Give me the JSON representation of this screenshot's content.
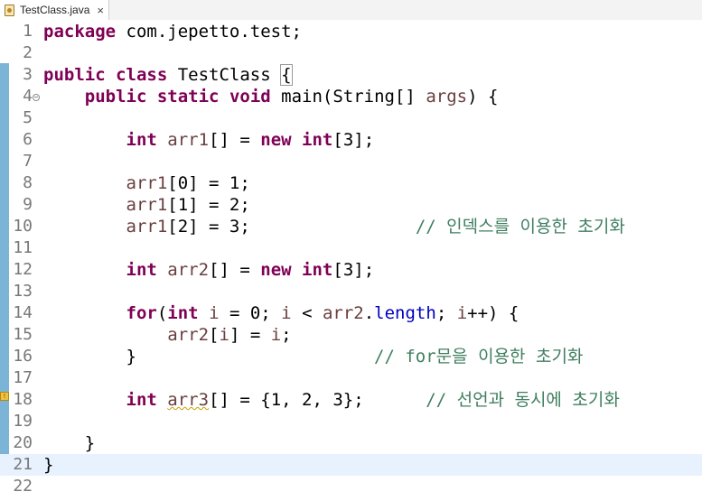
{
  "tab": {
    "filename": "TestClass.java",
    "close_glyph": "×"
  },
  "lines": [
    {
      "num": "1",
      "tokens": [
        {
          "t": "package",
          "c": "kw"
        },
        {
          "t": " com.jepetto.test;"
        }
      ]
    },
    {
      "num": "2",
      "tokens": []
    },
    {
      "num": "3",
      "tokens": [
        {
          "t": "public",
          "c": "kw"
        },
        {
          "t": " "
        },
        {
          "t": "class",
          "c": "kw"
        },
        {
          "t": " TestClass "
        },
        {
          "t": "{",
          "c": "brace-hl"
        }
      ]
    },
    {
      "num": "4",
      "fold": "−",
      "tokens": [
        {
          "t": "    "
        },
        {
          "t": "public",
          "c": "kw"
        },
        {
          "t": " "
        },
        {
          "t": "static",
          "c": "kw"
        },
        {
          "t": " "
        },
        {
          "t": "void",
          "c": "kw"
        },
        {
          "t": " main(String[] "
        },
        {
          "t": "args",
          "c": "local"
        },
        {
          "t": ") {"
        }
      ]
    },
    {
      "num": "5",
      "tokens": []
    },
    {
      "num": "6",
      "tokens": [
        {
          "t": "        "
        },
        {
          "t": "int",
          "c": "kw"
        },
        {
          "t": " "
        },
        {
          "t": "arr1",
          "c": "local"
        },
        {
          "t": "[] = "
        },
        {
          "t": "new",
          "c": "kw"
        },
        {
          "t": " "
        },
        {
          "t": "int",
          "c": "kw"
        },
        {
          "t": "[3];"
        }
      ]
    },
    {
      "num": "7",
      "tokens": []
    },
    {
      "num": "8",
      "tokens": [
        {
          "t": "        "
        },
        {
          "t": "arr1",
          "c": "local"
        },
        {
          "t": "[0] = 1;"
        }
      ]
    },
    {
      "num": "9",
      "tokens": [
        {
          "t": "        "
        },
        {
          "t": "arr1",
          "c": "local"
        },
        {
          "t": "[1] = 2;"
        }
      ]
    },
    {
      "num": "10",
      "tokens": [
        {
          "t": "        "
        },
        {
          "t": "arr1",
          "c": "local"
        },
        {
          "t": "[2] = 3;                "
        },
        {
          "t": "// 인덱스를 이용한 초기화",
          "c": "comment"
        }
      ]
    },
    {
      "num": "11",
      "tokens": []
    },
    {
      "num": "12",
      "tokens": [
        {
          "t": "        "
        },
        {
          "t": "int",
          "c": "kw"
        },
        {
          "t": " "
        },
        {
          "t": "arr2",
          "c": "local"
        },
        {
          "t": "[] = "
        },
        {
          "t": "new",
          "c": "kw"
        },
        {
          "t": " "
        },
        {
          "t": "int",
          "c": "kw"
        },
        {
          "t": "[3];"
        }
      ]
    },
    {
      "num": "13",
      "tokens": []
    },
    {
      "num": "14",
      "tokens": [
        {
          "t": "        "
        },
        {
          "t": "for",
          "c": "kw"
        },
        {
          "t": "("
        },
        {
          "t": "int",
          "c": "kw"
        },
        {
          "t": " "
        },
        {
          "t": "i",
          "c": "local"
        },
        {
          "t": " = 0; "
        },
        {
          "t": "i",
          "c": "local"
        },
        {
          "t": " < "
        },
        {
          "t": "arr2",
          "c": "local"
        },
        {
          "t": "."
        },
        {
          "t": "length",
          "c": "field"
        },
        {
          "t": "; "
        },
        {
          "t": "i",
          "c": "local"
        },
        {
          "t": "++) {"
        }
      ]
    },
    {
      "num": "15",
      "tokens": [
        {
          "t": "            "
        },
        {
          "t": "arr2",
          "c": "local"
        },
        {
          "t": "["
        },
        {
          "t": "i",
          "c": "local"
        },
        {
          "t": "] = "
        },
        {
          "t": "i",
          "c": "local"
        },
        {
          "t": ";"
        }
      ]
    },
    {
      "num": "16",
      "tokens": [
        {
          "t": "        }                       "
        },
        {
          "t": "// for문을 이용한 초기화",
          "c": "comment"
        }
      ]
    },
    {
      "num": "17",
      "tokens": []
    },
    {
      "num": "18",
      "warn": true,
      "tokens": [
        {
          "t": "        "
        },
        {
          "t": "int",
          "c": "kw"
        },
        {
          "t": " "
        },
        {
          "t": "arr3",
          "c": "local squiggle"
        },
        {
          "t": "[] = {1, 2, 3};      "
        },
        {
          "t": "// 선언과 동시에 초기화",
          "c": "comment"
        }
      ]
    },
    {
      "num": "19",
      "tokens": []
    },
    {
      "num": "20",
      "tokens": [
        {
          "t": "    }"
        }
      ]
    },
    {
      "num": "21",
      "current": true,
      "tokens": [
        {
          "t": "}"
        }
      ]
    },
    {
      "num": "22",
      "tokens": []
    }
  ]
}
